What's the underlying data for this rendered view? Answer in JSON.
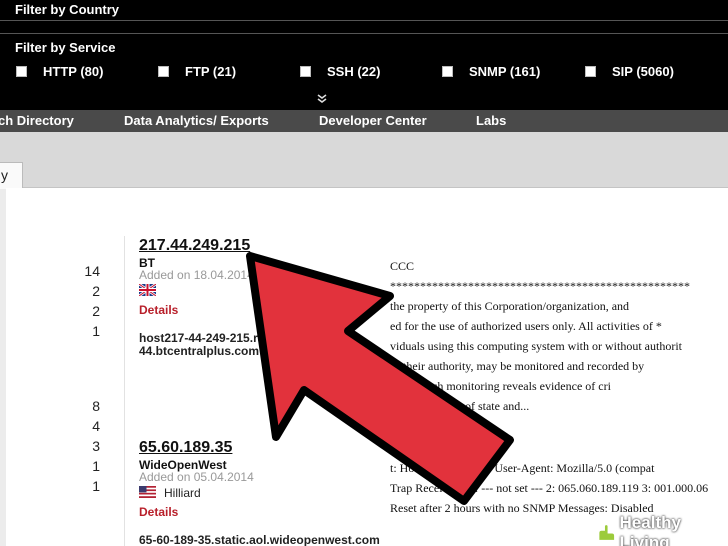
{
  "filters": {
    "country_label": "Filter by Country",
    "service_label": "Filter by Service",
    "services": [
      "HTTP (80)",
      "FTP (21)",
      "SSH (22)",
      "SNMP (161)",
      "SIP (5060)"
    ],
    "expand_glyph": "»"
  },
  "nav": {
    "items": [
      "ch Directory",
      "Data Analytics/ Exports",
      "Developer Center",
      "Labs"
    ]
  },
  "tabs": {
    "active_fragment": "y"
  },
  "counts": {
    "group1": [
      "14",
      "2",
      "2",
      "1"
    ],
    "group2": [
      "8",
      "4",
      "3",
      "1",
      "1"
    ]
  },
  "results": [
    {
      "ip": "217.44.249.215",
      "org": "BT",
      "added": "Added on 18.04.2014",
      "details": "Details",
      "hostname_line1": "host217-44-249-215.range217",
      "hostname_line2": "44.btcentralplus.com",
      "banner": [
        "CCC",
        "**************************************************",
        "the property of this Corporation/organization, and",
        "ed for the use of authorized users only. All activities of *",
        "viduals using this computing system with or without authorit",
        "of their authority, may be monitored and recorded by",
        "If any such monitoring reveals evidence of cri",
        "* activity    ation of state and..."
      ]
    },
    {
      "ip": "65.60.189.35",
      "org": "WideOpenWest",
      "added": "Added on 05.04.2014",
      "city": "Hilliard",
      "details": "Details",
      "hostname_line1": "65-60-189-35.static.aol.wideopenwest.com",
      "banner": [
        "t: Host: proxyj, Trap: User-Agent: Mozilla/5.0 (compat",
        "Trap Receivers: 1: --- not set --- 2: 065.060.189.119 3: 001.000.06",
        "Reset after 2 hours with no SNMP Messages: Disabled"
      ]
    }
  ],
  "watermark": {
    "text": "Healthy Living",
    "icon": "wikihow-hands-icon",
    "color": "#9ccb3b"
  },
  "colors": {
    "arrow": "#e2323c",
    "details_link": "#b81f2a"
  }
}
